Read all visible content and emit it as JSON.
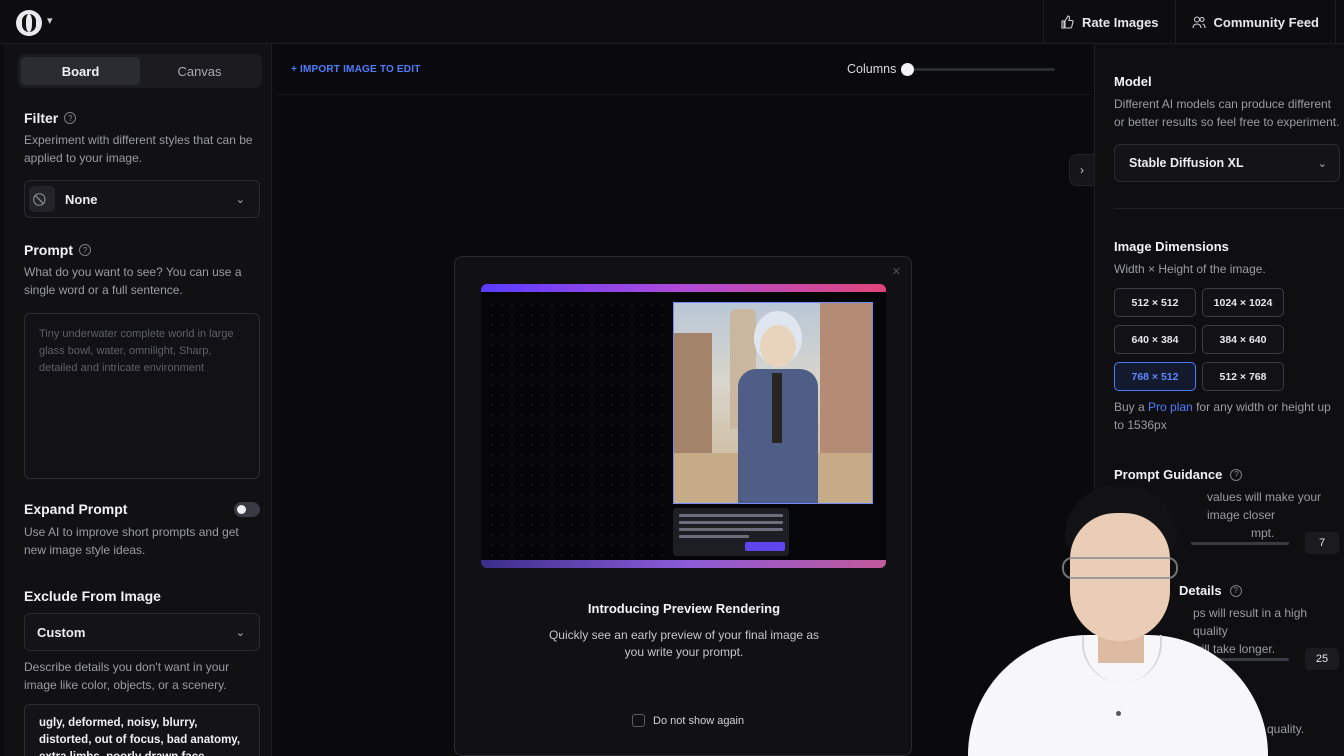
{
  "topbar": {
    "rate_images": "Rate Images",
    "community_feed": "Community Feed"
  },
  "left": {
    "tabs": [
      "Board",
      "Canvas"
    ],
    "active_tab": "Board",
    "filter": {
      "title": "Filter",
      "desc": "Experiment with different styles that can be applied to your image.",
      "value": "None"
    },
    "prompt": {
      "title": "Prompt",
      "desc": "What do you want to see? You can use a single word or a full sentence.",
      "placeholder": "Tiny underwater complete world in large glass bowl, water, omnilight, Sharp, detailed and intricate environment"
    },
    "expand": {
      "title": "Expand Prompt",
      "desc": "Use AI to improve short prompts and get new image style ideas.",
      "enabled": true
    },
    "exclude": {
      "title": "Exclude From Image",
      "value": "Custom",
      "desc": "Describe details you don't want in your image like color, objects, or a scenery.",
      "text": "ugly, deformed, noisy, blurry, distorted, out of focus, bad anatomy, extra limbs, poorly drawn face, poorly drawn hands"
    }
  },
  "center": {
    "import_label": "+ IMPORT IMAGE TO EDIT",
    "columns_label": "Columns",
    "columns_value": 0.0
  },
  "modal": {
    "title": "Introducing Preview Rendering",
    "desc": "Quickly see an early preview of your final image as you write your prompt.",
    "dont_show": "Do not show again"
  },
  "right": {
    "model": {
      "title": "Model",
      "desc": "Different AI models can produce different or better results so feel free to experiment.",
      "value": "Stable Diffusion XL"
    },
    "dimensions": {
      "title": "Image Dimensions",
      "desc": "Width × Height of the image.",
      "options": [
        "512 × 512",
        "1024 × 1024",
        "640 × 384",
        "384 × 640",
        "768 × 512",
        "512 × 768"
      ],
      "selected": "768 × 512",
      "pro_prefix": "Buy a",
      "pro_link": "Pro plan",
      "pro_suffix": "for any width or height up to 1536px"
    },
    "guidance": {
      "title": "Prompt Guidance",
      "desc_partial": "values will make your image closer",
      "desc_partial2": "mpt.",
      "value": "7"
    },
    "details": {
      "title_partial": "Details",
      "desc_partial": "ps will result in a high quality",
      "desc_partial2": "will take longer.",
      "value": "25",
      "tail": "d quality."
    }
  },
  "colors": {
    "accent": "#4f7dff",
    "background": "#0b0b0d"
  }
}
